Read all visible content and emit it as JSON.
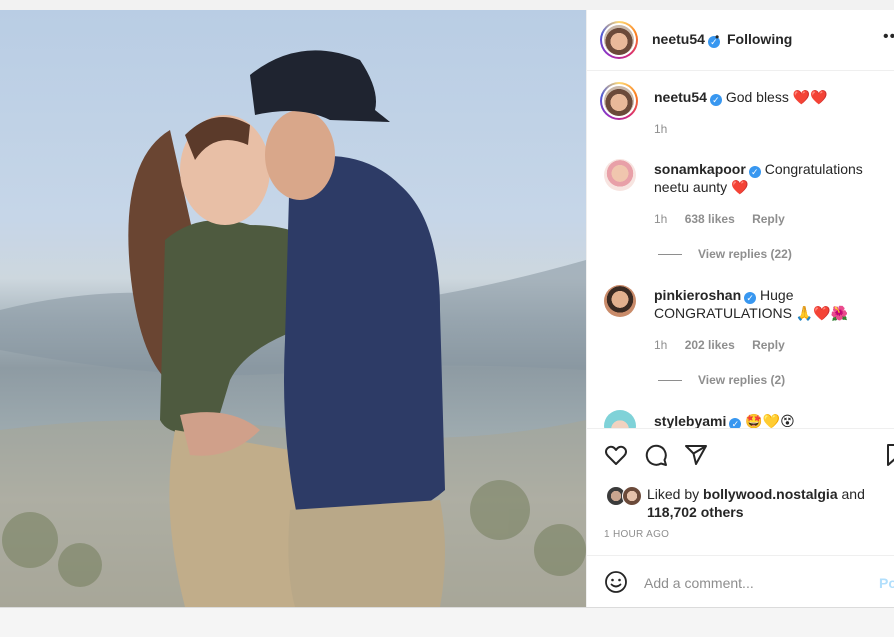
{
  "header": {
    "username": "neetu54",
    "separator": "•",
    "follow_label": "Following",
    "more_label": "•••"
  },
  "caption": {
    "username": "neetu54",
    "text": "God bless",
    "emoji": "❤️❤️",
    "time": "1h"
  },
  "comments": [
    {
      "username": "sonamkapoor",
      "text": "Congratulations neetu aunty",
      "emoji": "❤️",
      "time": "1h",
      "likes": "638 likes",
      "reply": "Reply",
      "view_replies": "View replies (22)"
    },
    {
      "username": "pinkieroshan",
      "text": "Huge CONGRATULATIONS",
      "emoji": "🙏❤️🌺",
      "time": "1h",
      "likes": "202 likes",
      "reply": "Reply",
      "view_replies": "View replies (2)"
    },
    {
      "username": "stylebyami",
      "text": "",
      "emoji": "🤩💛😵"
    }
  ],
  "likes": {
    "prefix": "Liked by",
    "user": "bollywood.nostalgia",
    "and": "and",
    "count": "118,702 others"
  },
  "time_ago": "1 HOUR AGO",
  "add_comment": {
    "placeholder": "Add a comment...",
    "post_label": "Po"
  },
  "icons": [
    "heart-icon",
    "comment-icon",
    "share-icon",
    "bookmark-icon",
    "emoji-icon"
  ]
}
